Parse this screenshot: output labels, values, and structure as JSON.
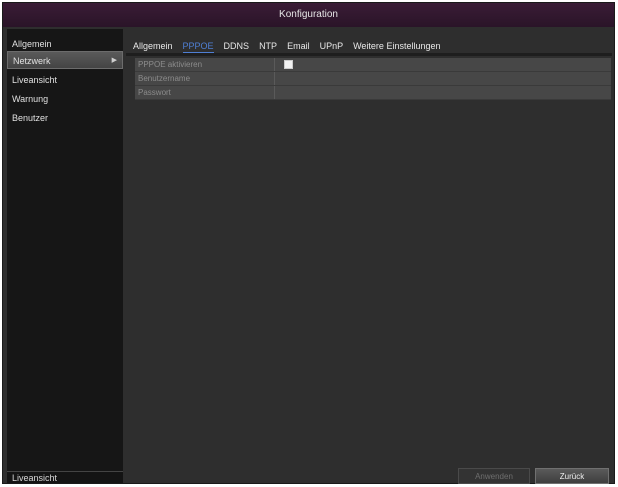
{
  "window": {
    "title": "Konfiguration"
  },
  "sidebar": {
    "items": [
      {
        "label": "Allgemein",
        "active": false
      },
      {
        "label": "Netzwerk",
        "active": true,
        "arrow": "▶"
      },
      {
        "label": "Liveansicht",
        "active": false
      },
      {
        "label": "Warnung",
        "active": false
      },
      {
        "label": "Benutzer",
        "active": false
      }
    ],
    "bottom_label": "Liveansicht"
  },
  "tabs": [
    {
      "label": "Allgemein",
      "active": false
    },
    {
      "label": "PPPOE",
      "active": true
    },
    {
      "label": "DDNS",
      "active": false
    },
    {
      "label": "NTP",
      "active": false
    },
    {
      "label": "Email",
      "active": false
    },
    {
      "label": "UPnP",
      "active": false
    },
    {
      "label": "Weitere Einstellungen",
      "active": false
    }
  ],
  "form": {
    "rows": [
      {
        "label": "PPPOE aktivieren",
        "type": "checkbox",
        "checked": false
      },
      {
        "label": "Benutzername",
        "type": "text",
        "value": ""
      },
      {
        "label": "Passwort",
        "type": "password",
        "value": ""
      }
    ]
  },
  "buttons": {
    "apply_label": "Anwenden",
    "back_label": "Zurück"
  },
  "colors": {
    "active_tab": "#4f7fd4",
    "titlebar": "#3a1c36",
    "background": "#2e2e2e"
  }
}
